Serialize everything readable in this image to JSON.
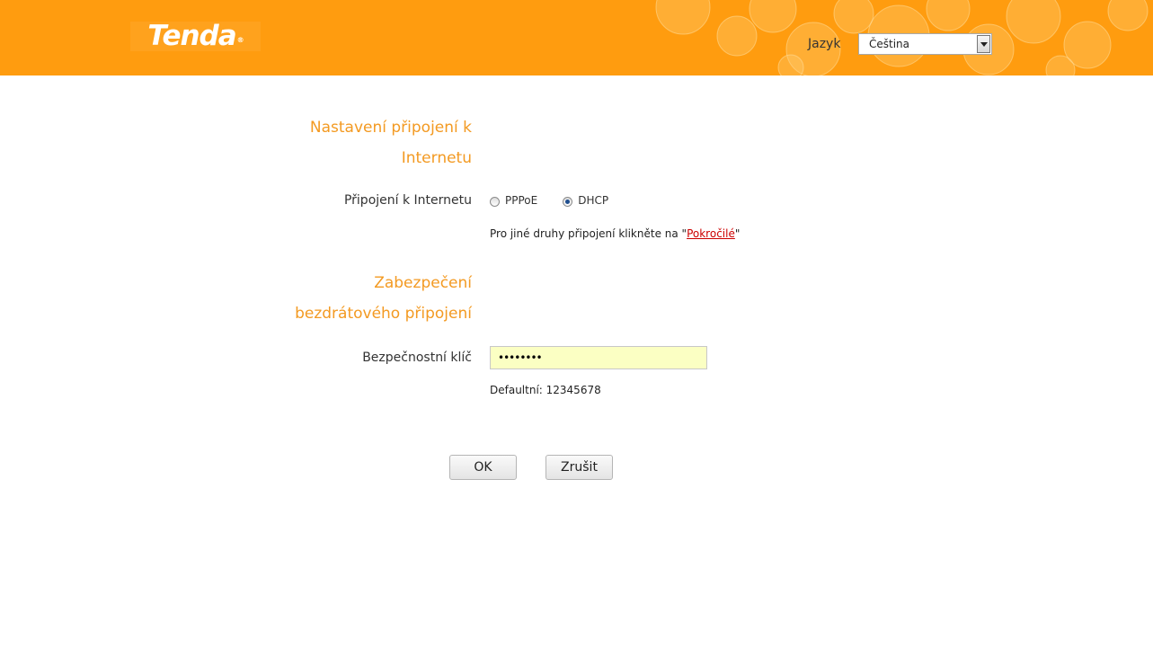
{
  "header": {
    "logo_text": "Tenda",
    "logo_mark": "®",
    "language_label": "Jazyk",
    "language_value": "Čeština"
  },
  "internet_section": {
    "title_line1": "Nastavení připojení k",
    "title_line2": "Internetu",
    "connection_label": "Připojení k Internetu",
    "options": [
      "PPPoE",
      "DHCP"
    ],
    "selected": "DHCP",
    "hint_prefix": "Pro jiné druhy připojení klikněte na \"",
    "hint_link": "Pokročilé",
    "hint_suffix": "\""
  },
  "wireless_section": {
    "title_line1": "Zabezpečení",
    "title_line2": "bezdrátového připojení",
    "key_label": "Bezpečnostní klíč",
    "key_value": "12345678",
    "default_note": "Defaultní: 12345678"
  },
  "buttons": {
    "ok_label": "OK",
    "cancel_label": "Zrušit"
  },
  "colors": {
    "header_bg": "#ff9c0f",
    "section_title": "#f39a22",
    "link": "#cc0000",
    "input_bg": "#fbffc3"
  }
}
